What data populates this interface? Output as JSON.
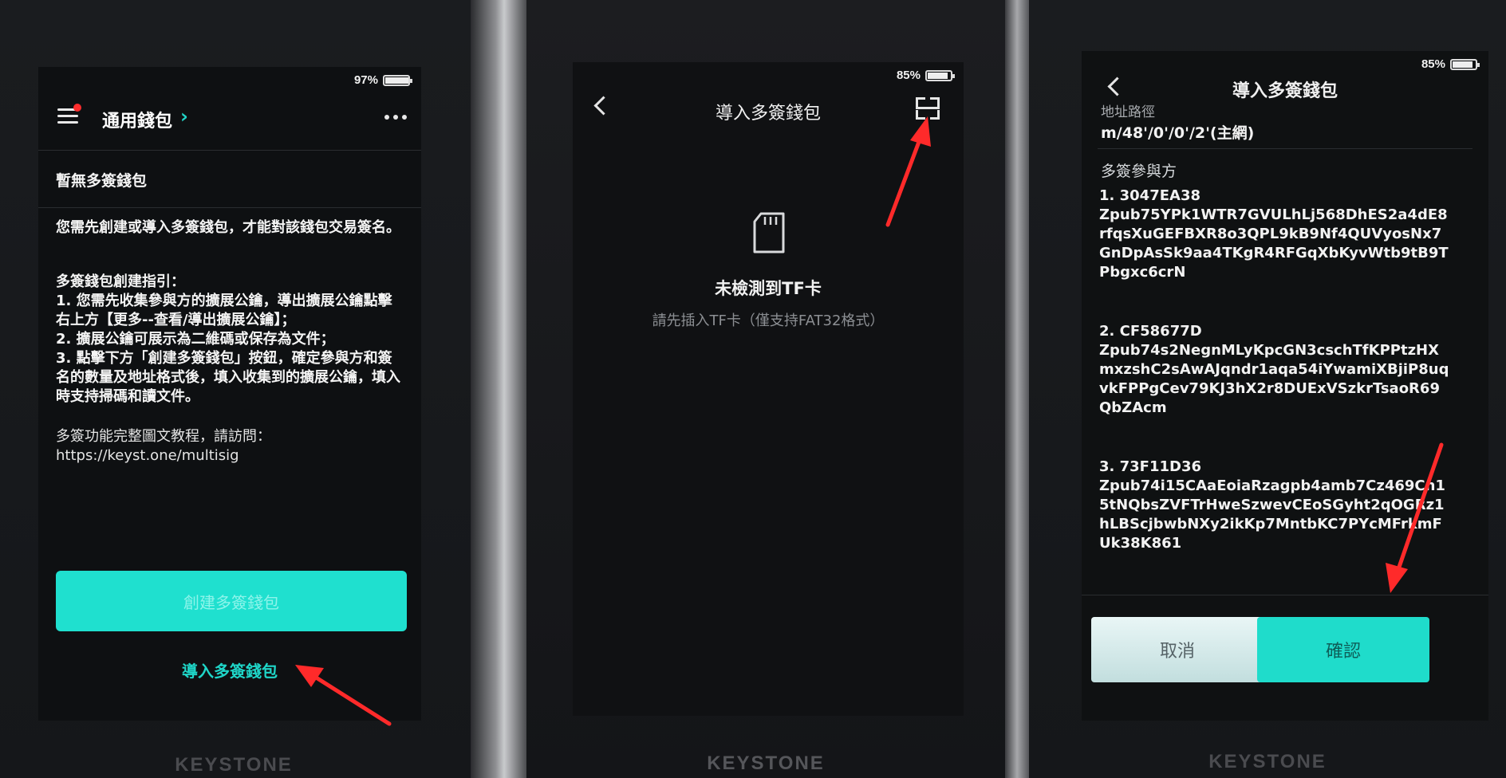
{
  "device1": {
    "status": {
      "battery_text": "97%",
      "battery_level": 0.97
    },
    "header": {
      "title": "通用錢包",
      "chevron_icon": "chevron-right-icon",
      "menu_icon": "menu-icon",
      "more_icon": "more-icon"
    },
    "empty_title": "暫無多簽錢包",
    "intro": "您需先創建或導入多簽錢包，才能對該錢包交易簽名。",
    "guide": "多簽錢包創建指引：\n1. 您需先收集參與方的擴展公鑰，導出擴展公鑰點擊右上方【更多--查看/導出擴展公鑰】；\n2. 擴展公鑰可展示為二維碼或保存為文件；\n3. 點擊下方「創建多簽錢包」按鈕，確定參與方和簽名的數量及地址格式後，填入收集到的擴展公鑰，填入時支持掃碼和讀文件。",
    "tutorial": "多簽功能完整圖文教程，請訪問：\nhttps://keyst.one/multisig",
    "create_button": "創建多簽錢包",
    "import_link": "導入多簽錢包",
    "brand": "KEYSTONE"
  },
  "device2": {
    "status": {
      "battery_text": "85%",
      "battery_level": 0.85
    },
    "header": {
      "title": "導入多簽錢包",
      "back_icon": "back-icon",
      "scan_icon": "scan-icon"
    },
    "sd_icon": "sd-card-icon",
    "no_tf": "未檢測到TF卡",
    "hint": "請先插入TF卡（僅支持FAT32格式）",
    "brand": "KEYSTONE"
  },
  "device3": {
    "status": {
      "battery_text": "85%",
      "battery_level": 0.85
    },
    "header": {
      "title": "導入多簽錢包",
      "back_icon": "back-icon"
    },
    "path_label": "地址路徑",
    "path_value": "m/48'/0'/0'/2'(主網)",
    "participants_label": "多簽參與方",
    "cosigners": [
      {
        "id": "1. 3047EA38",
        "xpub": "Zpub75YPk1WTR7GVULhLj568DhES2a4dE8rfqsXuGEFBXR8o3QPL9kB9Nf4QUVyosNx7GnDpAsSk9aa4TKgR4RFGqXbKyvWtb9tB9TPbgxc6crN"
      },
      {
        "id": "2. CF58677D",
        "xpub": "Zpub74s2NegnMLyKpcGN3cschTfKPPtzHXmxzshC2sAwAJqndr1aqa54iYwamiXBjiP8uqvkFPPgCev79KJ3hX2r8DUExVSzkrTsaoR69QbZAcm"
      },
      {
        "id": "3. 73F11D36",
        "xpub": "Zpub74i15CAaEoiaRzagpb4amb7Cz469Cn15tNQbsZVFTrHweSzwevCEoSGyht2qOGRz1hLBScjbwbNXy2ikKp7MntbKC7PYcMFrkmFUk38K861"
      }
    ],
    "cancel_button": "取消",
    "confirm_button": "確認",
    "brand": "KEYSTONE"
  },
  "colors": {
    "accent": "#1fdccb",
    "arrow": "#ff2a2a",
    "background": "#0f1113"
  }
}
